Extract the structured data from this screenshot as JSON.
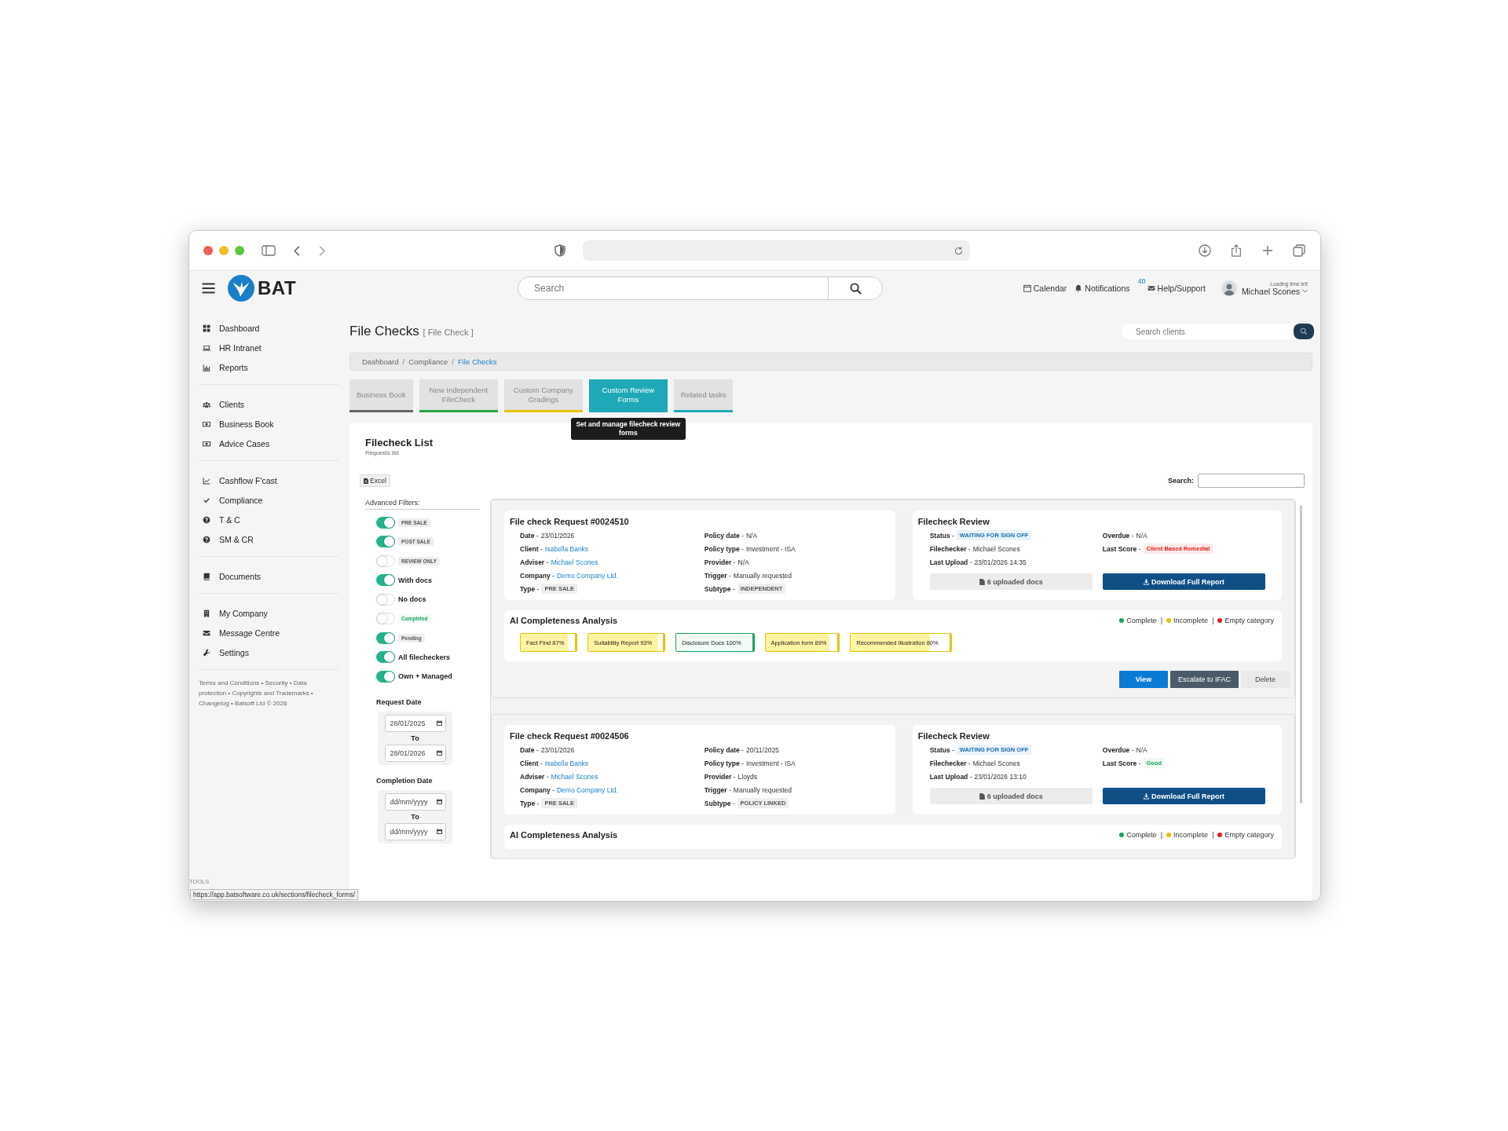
{
  "app": {
    "logo_text": "BAT",
    "search_placeholder": "Search",
    "nav": [
      {
        "kind": "calendar",
        "label": "Calendar"
      },
      {
        "kind": "bell",
        "label": "Notifications"
      },
      {
        "kind": "badge",
        "label": "40"
      },
      {
        "kind": "envelope",
        "label": "Help/Support"
      }
    ],
    "user": {
      "hint": "Loading time left",
      "name": "Michael Scones"
    }
  },
  "sidebar": {
    "groups": [
      [
        {
          "label": "Dashboard"
        },
        {
          "label": "HR Intranet"
        },
        {
          "label": "Reports"
        }
      ],
      [
        {
          "label": "Clients"
        },
        {
          "label": "Business Book"
        },
        {
          "label": "Advice Cases"
        }
      ],
      [
        {
          "label": "Cashflow F'cast"
        },
        {
          "label": "Compliance"
        },
        {
          "label": "T & C"
        },
        {
          "label": "SM & CR"
        }
      ],
      [
        {
          "label": "Documents"
        }
      ],
      [
        {
          "label": "My Company"
        },
        {
          "label": "Message Centre"
        },
        {
          "label": "Settings"
        }
      ]
    ],
    "footer": "Terms and Conditions • Security • Data protection • Copyrights and Trademarks • Changelog • Batsoft Ltd © 2026"
  },
  "page": {
    "title": "File Checks",
    "subtitle": "[ File Check ]",
    "client_search_placeholder": "Search clients",
    "breadcrumb": [
      {
        "label": "Dashboard",
        "current": false
      },
      {
        "label": "Compliance",
        "current": false
      },
      {
        "label": "File Checks",
        "current": true
      }
    ],
    "breadcrumb_separator": "/",
    "tabs": [
      {
        "label": "Business Book",
        "selected": false,
        "color": "#666666"
      },
      {
        "label": "New Independent FileCheck",
        "selected": false,
        "color": "#28a745"
      },
      {
        "label": "Custom Company Gradings",
        "selected": false,
        "color": "#e6c300"
      },
      {
        "label": "Custom Review Forms",
        "selected": true,
        "color": "#1fa9b8"
      },
      {
        "label": "Related tasks",
        "selected": false,
        "color": "#1fa9b8"
      }
    ],
    "tooltip": "Set and manage filecheck review forms"
  },
  "list": {
    "title": "Filecheck List",
    "subtitle": "Requests list",
    "excel_button": "Excel",
    "search_label": "Search:",
    "filters_title": "Advanced Filters:",
    "filters": [
      {
        "label": "PRE SALE",
        "kind": "tag",
        "on": true
      },
      {
        "label": "POST SALE",
        "kind": "tag",
        "on": true
      },
      {
        "label": "REVIEW ONLY",
        "kind": "tag",
        "on": false
      },
      {
        "label": "With docs",
        "kind": "text",
        "on": true
      },
      {
        "label": "No docs",
        "kind": "text",
        "on": false
      },
      {
        "label": "Completed",
        "kind": "success_tag",
        "on": false
      },
      {
        "label": "Pending",
        "kind": "tag",
        "on": true
      },
      {
        "label": "All filecheckers",
        "kind": "text",
        "on": true
      },
      {
        "label": "Own + Managed",
        "kind": "text",
        "on": true
      }
    ],
    "date_filters": [
      {
        "title": "Request Date",
        "from": {
          "value": "28/01/2025"
        },
        "separator": "To",
        "to": {
          "value": "28/01/2026"
        }
      },
      {
        "title": "Completion Date",
        "from": {
          "placeholder": "dd/mm/yyyy"
        },
        "separator": "To",
        "to": {
          "placeholder": "dd/mm/yyyy"
        }
      }
    ],
    "records": [
      {
        "title": "File check Request #0024510",
        "columns": [
          [
            {
              "label": "**Date** -",
              "value": "23/01/2026",
              "kind": "text"
            },
            {
              "label": "**Client** -",
              "value": "Isabella Banks",
              "kind": "link"
            },
            {
              "label": "**Adviser** -",
              "value": "Michael Scones",
              "kind": "link"
            },
            {
              "label": "**Company** -",
              "value": "Demo Company Ltd.",
              "kind": "link"
            },
            {
              "label": "**Type** -",
              "value": "PRE SALE",
              "kind": "tag"
            }
          ],
          [
            {
              "label": "**Policy date** -",
              "value": "N/A",
              "kind": "text"
            },
            {
              "label": "**Policy type** -",
              "value": "Investment - ISA",
              "kind": "text"
            },
            {
              "label": "**Provider** -",
              "value": "N/A",
              "kind": "text"
            },
            {
              "label": "**Trigger** -",
              "value": "Manually requested",
              "kind": "text"
            },
            {
              "label": "**Subtype** -",
              "value": "INDEPENDENT",
              "kind": "tag"
            }
          ]
        ],
        "review": {
          "title": "Filecheck Review",
          "columns": [
            [
              {
                "label": "**Status** -",
                "value": "WAITING FOR SIGN OFF",
                "kind": "info_tag"
              },
              {
                "label": "**Filechecker** -",
                "value": "Michael Scones",
                "kind": "text"
              },
              {
                "label": "**Last Upload** -",
                "value": "23/01/2026 14:35",
                "kind": "text"
              }
            ],
            [
              {
                "label": "**Overdue** -",
                "value": "N/A",
                "kind": "text"
              },
              {
                "label": "**Last Score** -",
                "value": "Client Based Remedial",
                "kind": "danger_tag"
              }
            ]
          ],
          "docs_button": "6 uploaded docs",
          "download_button": "Download Full Report"
        },
        "ai": {
          "title": "AI Completeness Analysis",
          "legend": [
            {
              "label": "Complete",
              "color": "#1aa260",
              "separator_after": "|"
            },
            {
              "label": "Incomplete",
              "color": "#e6c300",
              "separator_after": "|"
            },
            {
              "label": "Empty category",
              "color": "#e01e1e"
            }
          ],
          "chips": [
            {
              "label": "Fact Find 87%",
              "level": 0.87,
              "complete": false
            },
            {
              "label": "Suitability Report 93%",
              "level": 0.93,
              "complete": false
            },
            {
              "label": "Disclosure Docs 100%",
              "level": 1,
              "complete": true
            },
            {
              "label": "Application form 89%",
              "level": 0.89,
              "complete": false
            },
            {
              "label": "Recommended Illustration 80%",
              "level": 0.8,
              "complete": false
            }
          ]
        },
        "actions": [
          {
            "label": "View",
            "kind": "primary"
          },
          {
            "label": "Escalate to IFAC",
            "kind": "dark"
          },
          {
            "label": "Delete",
            "kind": "light"
          }
        ]
      },
      {
        "title": "File check Request #0024506",
        "columns": [
          [
            {
              "label": "**Date** -",
              "value": "23/01/2026",
              "kind": "text"
            },
            {
              "label": "**Client** -",
              "value": "Isabella Banks",
              "kind": "link"
            },
            {
              "label": "**Adviser** -",
              "value": "Michael Scones",
              "kind": "link"
            },
            {
              "label": "**Company** -",
              "value": "Demo Company Ltd.",
              "kind": "link"
            },
            {
              "label": "**Type** -",
              "value": "PRE SALE",
              "kind": "tag"
            }
          ],
          [
            {
              "label": "**Policy date** -",
              "value": "20/11/2025",
              "kind": "text"
            },
            {
              "label": "**Policy type** -",
              "value": "Investment - ISA",
              "kind": "text"
            },
            {
              "label": "**Provider** -",
              "value": "Lloyds",
              "kind": "text"
            },
            {
              "label": "**Trigger** -",
              "value": "Manually requested",
              "kind": "text"
            },
            {
              "label": "**Subtype** -",
              "value": "POLICY LINKED",
              "kind": "tag"
            }
          ]
        ],
        "review": {
          "title": "Filecheck Review",
          "columns": [
            [
              {
                "label": "**Status** -",
                "value": "WAITING FOR SIGN OFF",
                "kind": "info_tag"
              },
              {
                "label": "**Filechecker** -",
                "value": "Michael Scones",
                "kind": "text"
              },
              {
                "label": "**Last Upload** -",
                "value": "23/01/2026 13:10",
                "kind": "text"
              }
            ],
            [
              {
                "label": "**Overdue** -",
                "value": "N/A",
                "kind": "text"
              },
              {
                "label": "**Last Score** -",
                "value": "Good",
                "kind": "success_tag"
              }
            ]
          ],
          "docs_button": "6 uploaded docs",
          "download_button": "Download Full Report"
        },
        "ai": {
          "title": "AI Completeness Analysis",
          "legend": [
            {
              "label": "Complete",
              "color": "#1aa260",
              "separator_after": "|"
            },
            {
              "label": "Incomplete",
              "color": "#e6c300",
              "separator_after": "|"
            },
            {
              "label": "Empty category",
              "color": "#e01e1e"
            }
          ]
        }
      }
    ]
  },
  "tools_label": "TOOLS",
  "status_url": "https://app.batsoftware.co.uk/sections/filecheck_forms/"
}
